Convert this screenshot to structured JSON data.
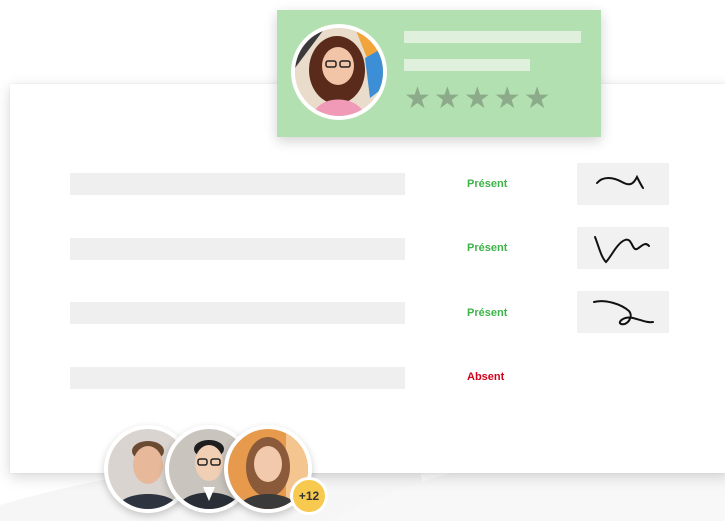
{
  "profile_card": {
    "rating": {
      "value": 5,
      "max": 5
    },
    "colors": {
      "background": "#b3e0b0",
      "star": "#8cab8a"
    }
  },
  "attendance": {
    "rows": [
      {
        "status": "Présent",
        "state": "present",
        "signed": true
      },
      {
        "status": "Présent",
        "state": "present",
        "signed": true
      },
      {
        "status": "Présent",
        "state": "present",
        "signed": true
      },
      {
        "status": "Absent",
        "state": "absent",
        "signed": false
      }
    ],
    "colors": {
      "present": "#3db34a",
      "absent": "#d0021b"
    }
  },
  "participants": {
    "more_count": "+12",
    "badge_color": "#f7c94e"
  }
}
